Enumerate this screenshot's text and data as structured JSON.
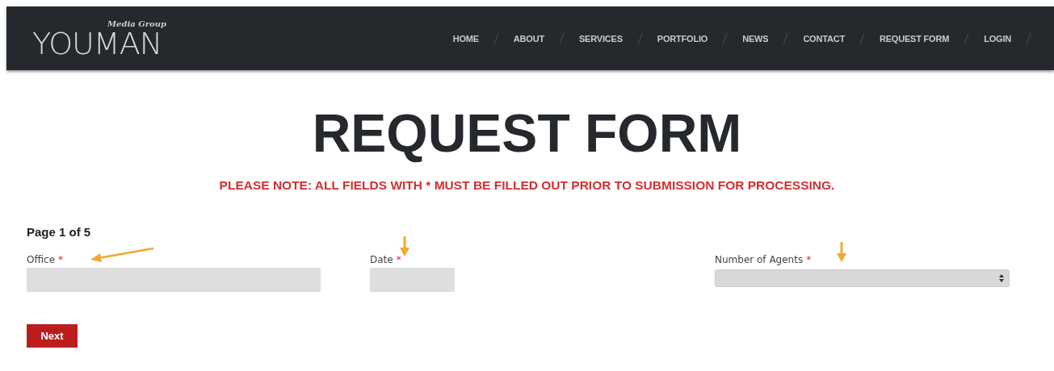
{
  "header": {
    "logo": {
      "main": "YOUMAN",
      "tagline": "Media Group"
    },
    "nav": [
      {
        "label": "HOME"
      },
      {
        "label": "ABOUT"
      },
      {
        "label": "SERVICES"
      },
      {
        "label": "PORTFOLIO"
      },
      {
        "label": "NEWS"
      },
      {
        "label": "CONTACT"
      },
      {
        "label": "REQUEST FORM"
      },
      {
        "label": "LOGIN"
      }
    ]
  },
  "title": "REQUEST FORM",
  "notice": "PLEASE NOTE: ALL FIELDS WITH * MUST BE FILLED OUT PRIOR TO SUBMISSION FOR PROCESSING.",
  "page_indicator": "Page 1 of 5",
  "fields": [
    {
      "kind": "text",
      "label": "Office",
      "mark": "*"
    },
    {
      "kind": "date",
      "label": "Date",
      "mark": "*"
    },
    {
      "kind": "select",
      "label": "Number of Agents",
      "mark": "*"
    }
  ],
  "buttons": [
    "Next"
  ]
}
